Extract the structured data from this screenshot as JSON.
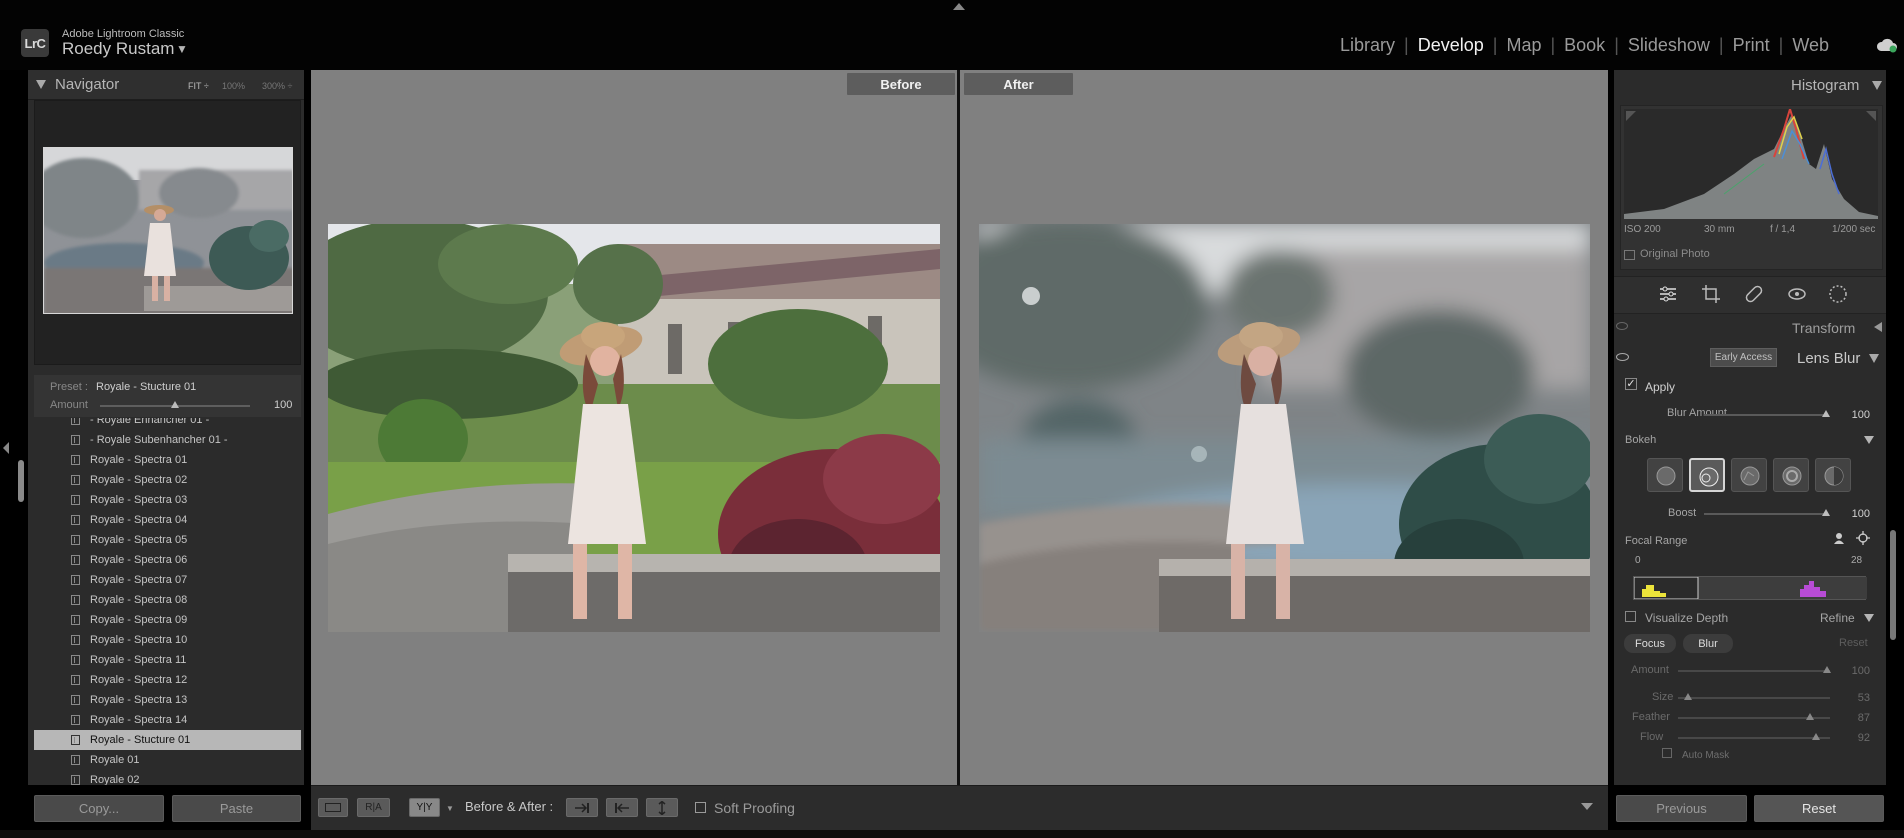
{
  "app": {
    "name": "Adobe Lightroom Classic",
    "logo": "LrC",
    "user": "Roedy Rustam",
    "user_caret": "▼"
  },
  "modules": [
    "Library",
    "Develop",
    "Map",
    "Book",
    "Slideshow",
    "Print",
    "Web"
  ],
  "active_module": "Develop",
  "navigator": {
    "title": "Navigator",
    "zoom_fit": "FIT ÷",
    "zoom_100": "100%",
    "zoom_300": "300% ÷"
  },
  "preset": {
    "label": "Preset :",
    "value": "Royale - Stucture 01",
    "amount_label": "Amount",
    "amount_value": "100",
    "amount_fraction": 0.5
  },
  "preset_list": [
    "- Royale Enhancher 01 -",
    "- Royale Subenhancher 01 -",
    "Royale - Spectra 01",
    "Royale - Spectra 02",
    "Royale - Spectra 03",
    "Royale - Spectra 04",
    "Royale - Spectra 05",
    "Royale - Spectra 06",
    "Royale - Spectra 07",
    "Royale - Spectra 08",
    "Royale - Spectra 09",
    "Royale - Spectra 10",
    "Royale - Spectra 11",
    "Royale - Spectra 12",
    "Royale - Spectra 13",
    "Royale - Spectra 14",
    "Royale - Stucture 01",
    "Royale 01",
    "Royale 02"
  ],
  "selected_preset": "Royale - Stucture 01",
  "left_buttons": {
    "copy": "Copy...",
    "paste": "Paste"
  },
  "view": {
    "before": "Before",
    "after": "After"
  },
  "toolbar": {
    "ra": "R|A",
    "yy": "Y|Y",
    "before_after_label": "Before & After :",
    "soft_proofing": "Soft Proofing"
  },
  "histogram": {
    "title": "Histogram",
    "iso": "ISO 200",
    "focal_length": "30 mm",
    "aperture": "f / 1,4",
    "shutter": "1/200 sec",
    "original_photo": "Original Photo"
  },
  "panels": {
    "transform": "Transform",
    "lens_blur": "Lens Blur",
    "early_access": "Early Access"
  },
  "lens_blur": {
    "apply": "Apply",
    "blur_amount_label": "Blur Amount",
    "blur_amount": "100",
    "bokeh_label": "Bokeh",
    "boost_label": "Boost",
    "boost": "100",
    "focal_range_label": "Focal Range",
    "focal_min": "0",
    "focal_max": "28",
    "visualize_depth": "Visualize Depth",
    "refine": "Refine",
    "focus": "Focus",
    "blur": "Blur",
    "reset": "Reset",
    "amount_label": "Amount",
    "amount": "100",
    "size_label": "Size",
    "size": "53",
    "feather_label": "Feather",
    "feather": "87",
    "flow_label": "Flow",
    "flow": "92",
    "auto_mask": "Auto Mask"
  },
  "right_buttons": {
    "previous": "Previous",
    "reset": "Reset"
  },
  "colors": {
    "panel": "#2b2b2b",
    "canvas": "#808080",
    "accent": "#f2f2f2"
  }
}
